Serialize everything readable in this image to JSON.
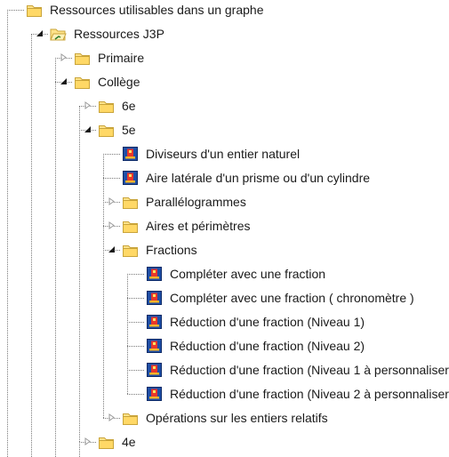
{
  "colors": {
    "folder_fill": "#ffe38a",
    "folder_stroke": "#c9a43a",
    "resource_bg": "#1f4fa6",
    "resource_accent": "#e8372b",
    "connector": "#7a7a7a"
  },
  "tree": [
    {
      "level": 1,
      "icon": "folder-icon",
      "state": "none",
      "label": "Ressources utilisables dans un graphe"
    },
    {
      "level": 2,
      "icon": "folder-open-icon",
      "state": "expanded",
      "label": "Ressources J3P"
    },
    {
      "level": 3,
      "icon": "folder-icon",
      "state": "collapsed",
      "label": "Primaire"
    },
    {
      "level": 3,
      "icon": "folder-icon",
      "state": "expanded",
      "label": "Collège"
    },
    {
      "level": 4,
      "icon": "folder-icon",
      "state": "collapsed",
      "label": "6e"
    },
    {
      "level": 4,
      "icon": "folder-icon",
      "state": "expanded",
      "label": "5e"
    },
    {
      "level": 5,
      "icon": "resource-icon",
      "state": "leaf",
      "label": "Diviseurs d'un entier naturel"
    },
    {
      "level": 5,
      "icon": "resource-icon",
      "state": "leaf",
      "label": "Aire latérale d'un prisme ou d'un cylindre"
    },
    {
      "level": 5,
      "icon": "folder-icon",
      "state": "collapsed",
      "label": "Parallélogrammes"
    },
    {
      "level": 5,
      "icon": "folder-icon",
      "state": "collapsed",
      "label": "Aires et périmètres"
    },
    {
      "level": 5,
      "icon": "folder-icon",
      "state": "expanded",
      "label": "Fractions"
    },
    {
      "level": 6,
      "icon": "resource-icon",
      "state": "leaf",
      "label": "Compléter avec une fraction"
    },
    {
      "level": 6,
      "icon": "resource-icon",
      "state": "leaf",
      "label": "Compléter avec une fraction ( chronomètre )"
    },
    {
      "level": 6,
      "icon": "resource-icon",
      "state": "leaf",
      "label": "Réduction d'une fraction (Niveau 1)"
    },
    {
      "level": 6,
      "icon": "resource-icon",
      "state": "leaf",
      "label": "Réduction d'une fraction (Niveau 2)"
    },
    {
      "level": 6,
      "icon": "resource-icon",
      "state": "leaf",
      "label": "Réduction d'une fraction (Niveau 1 à personnaliser)"
    },
    {
      "level": 6,
      "icon": "resource-icon",
      "state": "leaf",
      "label": "Réduction d'une fraction (Niveau 2 à personnaliser)"
    },
    {
      "level": 5,
      "icon": "folder-icon",
      "state": "collapsed",
      "label": "Opérations sur les entiers relatifs"
    },
    {
      "level": 4,
      "icon": "folder-icon",
      "state": "collapsed",
      "label": "4e"
    }
  ]
}
